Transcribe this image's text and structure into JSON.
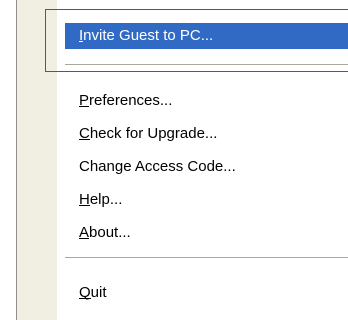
{
  "context_menu": {
    "items": [
      {
        "mnemonic": "I",
        "rest": "nvite Guest to PC..."
      },
      {
        "mnemonic": "P",
        "rest": "references..."
      },
      {
        "mnemonic": "C",
        "rest": "heck for Upgrade..."
      },
      {
        "plain": "Change Access Code..."
      },
      {
        "mnemonic": "H",
        "rest": "elp..."
      },
      {
        "mnemonic": "A",
        "rest": "bout..."
      },
      {
        "mnemonic": "Q",
        "rest": "uit"
      }
    ],
    "selected_item": "Invite Guest to PC...",
    "highlight_color": "#316ac5",
    "annotation_box_color": "#e02020"
  }
}
